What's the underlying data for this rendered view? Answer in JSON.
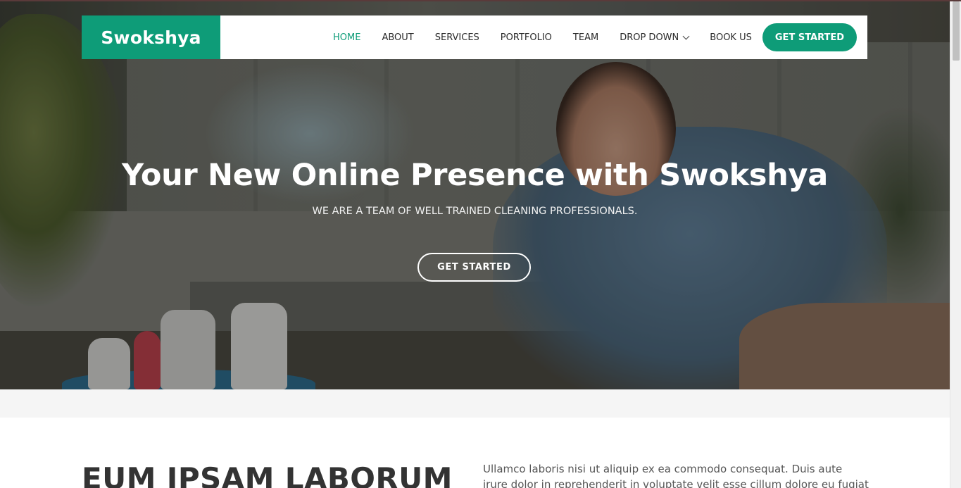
{
  "header": {
    "logo": "Swokshya",
    "nav": [
      "HOME",
      "ABOUT",
      "SERVICES",
      "PORTFOLIO",
      "TEAM",
      "DROP DOWN",
      "BOOK US"
    ],
    "active": "HOME",
    "cta": "GET STARTED"
  },
  "hero": {
    "title": "Your New Online Presence with Swokshya",
    "subtitle": "WE ARE A TEAM OF WELL TRAINED CLEANING PROFESSIONALS.",
    "cta": "GET STARTED"
  },
  "about": {
    "heading": "EUM IPSAM LABORUM",
    "text": "Ullamco laboris nisi ut aliquip ex ea commodo consequat. Duis aute irure dolor in reprehenderit in voluptate velit esse cillum dolore eu fugiat nulla"
  },
  "colors": {
    "accent": "#0e9c78"
  }
}
